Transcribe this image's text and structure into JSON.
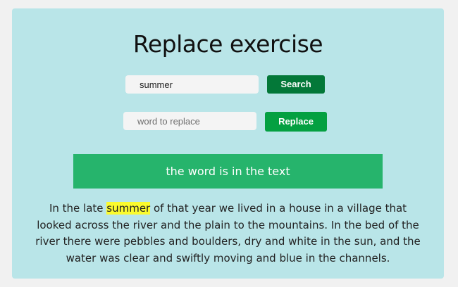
{
  "page": {
    "title": "Replace exercise"
  },
  "search": {
    "value": "summer",
    "button_label": "Search"
  },
  "replace": {
    "value": "",
    "placeholder": "word to replace",
    "button_label": "Replace"
  },
  "status": {
    "message": "the word is in the text"
  },
  "passage": {
    "before": "In the late ",
    "highlighted": "summer",
    "after": " of that year we lived in a house in a village that looked across the river and the plain to the mountains. In the bed of the river there were pebbles and boulders, dry and white in the sun, and the water was clear and swiftly moving and blue in the channels."
  },
  "colors": {
    "card_background": "#b9e5e8",
    "search_button": "#037838",
    "replace_button": "#04a041",
    "status_bar": "#26b46c",
    "highlight": "#fbfb2e"
  }
}
